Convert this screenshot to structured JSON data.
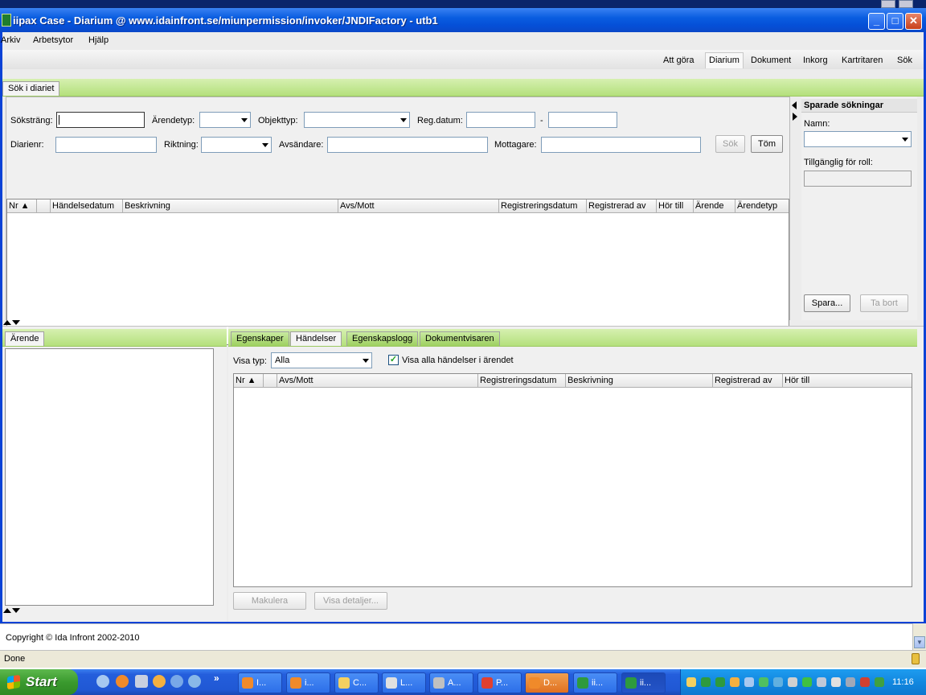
{
  "window": {
    "title": "iipax Case - Diarium @ www.idainfront.se/miunpermission/invoker/JNDIFactory - utb1",
    "minimize": "_",
    "maximize": "□",
    "close": "✕"
  },
  "menu": [
    "Arkiv",
    "Arbetsytor",
    "Hjälp"
  ],
  "nav": {
    "items": [
      "Att göra",
      "Diarium",
      "Dokument",
      "Inkorg",
      "Kartritaren",
      "Sök"
    ],
    "active": "Diarium"
  },
  "search_tab": "Sök i diariet",
  "search": {
    "sokstrang_label": "Söksträng:",
    "sokstrang_value": "",
    "arendetyp_label": "Ärendetyp:",
    "arendetyp_value": "",
    "objekttyp_label": "Objekttyp:",
    "objekttyp_value": "",
    "regdatum_label": "Reg.datum:",
    "regdatum_from": "",
    "regdatum_sep": "-",
    "regdatum_to": "",
    "diarienr_label": "Diarienr:",
    "diarienr_value": "",
    "riktning_label": "Riktning:",
    "riktning_value": "",
    "avsandare_label": "Avsändare:",
    "avsandare_value": "",
    "mottagare_label": "Mottagare:",
    "mottagare_value": "",
    "sok_button": "Sök",
    "tom_button": "Töm"
  },
  "results_table": {
    "columns": [
      "Nr ▲",
      "",
      "Händelsedatum",
      "Beskrivning",
      "Avs/Mott",
      "Registreringsdatum",
      "Registrerad av",
      "Hör till",
      "Ärende",
      "Ärendetyp"
    ],
    "rows": []
  },
  "saved_searches": {
    "title": "Sparade sökningar",
    "namn_label": "Namn:",
    "namn_value": "",
    "roll_label": "Tillgänglig för roll:",
    "roll_value": "",
    "spara_button": "Spara...",
    "ta_bort_button": "Ta bort"
  },
  "arende_tab": "Ärende",
  "detail": {
    "tabs": [
      "Egenskaper",
      "Händelser",
      "Egenskapslogg",
      "Dokumentvisaren"
    ],
    "active_tab": "Händelser",
    "visa_typ_label": "Visa typ:",
    "visa_typ_value": "Alla",
    "visa_alla_label": "Visa alla händelser i ärendet",
    "visa_alla_checked": true,
    "columns": [
      "Nr ▲",
      "",
      "Avs/Mott",
      "Registreringsdatum",
      "Beskrivning",
      "Registrerad av",
      "Hör till"
    ],
    "rows": [],
    "makulera_button": "Makulera",
    "visa_detaljer_button": "Visa detaljer..."
  },
  "browser_status": {
    "copyright": "Copyright © Ida Infront 2002-2010",
    "status": "Done"
  },
  "taskbar": {
    "start": "Start",
    "chevron": "»",
    "items": [
      {
        "label": "I...",
        "icon": "firefox-icon",
        "color": "#f08a2a"
      },
      {
        "label": "i...",
        "icon": "firefox-icon",
        "color": "#f08a2a"
      },
      {
        "label": "C...",
        "icon": "folder-icon",
        "color": "#f4d060"
      },
      {
        "label": "L...",
        "icon": "document-icon",
        "color": "#e0e0e0"
      },
      {
        "label": "A...",
        "icon": "camera-icon",
        "color": "#c0c0c0"
      },
      {
        "label": "P...",
        "icon": "pdf-icon",
        "color": "#e04030"
      },
      {
        "label": "D...",
        "icon": "firefox-icon",
        "color": "#f08a2a"
      },
      {
        "label": "ii...",
        "icon": "iipax-icon",
        "color": "#2e9a3e"
      },
      {
        "label": "ii...",
        "icon": "iipax-icon",
        "color": "#2e9a3e"
      }
    ],
    "clock": "11:16"
  }
}
